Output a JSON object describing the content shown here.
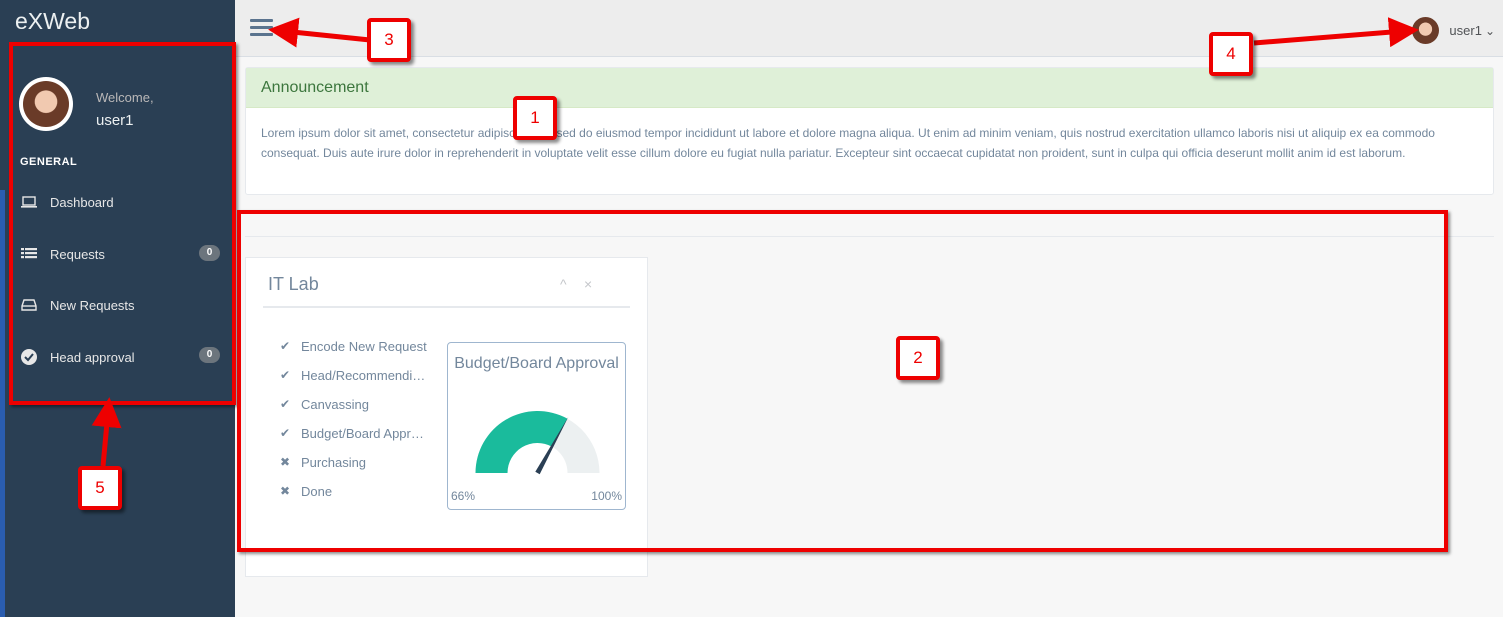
{
  "app": {
    "brand": "eXWeb"
  },
  "sidebar": {
    "welcome": "Welcome,",
    "username": "user1",
    "section": "GENERAL",
    "items": [
      {
        "label": "Dashboard",
        "icon": "laptop-icon",
        "badge": ""
      },
      {
        "label": "Requests",
        "icon": "list-icon",
        "badge": "0"
      },
      {
        "label": "New Requests",
        "icon": "inbox-icon",
        "badge": ""
      },
      {
        "label": "Head approval",
        "icon": "check-circle-icon",
        "badge": "0"
      }
    ]
  },
  "topbar": {
    "user": "user1",
    "caret": "⌄"
  },
  "announcement": {
    "title": "Announcement",
    "body": "Lorem ipsum dolor sit amet, consectetur adipiscing elit, sed do eiusmod tempor incididunt ut labore et dolore magna aliqua. Ut enim ad minim veniam, quis nostrud exercitation ullamco laboris nisi ut aliquip ex ea commodo consequat. Duis aute irure dolor in reprehenderit in voluptate velit esse cillum dolore eu fugiat nulla pariatur. Excepteur sint occaecat cupidatat non proident, sunt in culpa qui officia deserunt mollit anim id est laborum."
  },
  "panel": {
    "title": "IT Lab",
    "collapse_icon": "^",
    "close_icon": "×",
    "steps": [
      {
        "label": "Encode New Request",
        "status": "done",
        "icon": "✔"
      },
      {
        "label": "Head/Recommending Approval",
        "status": "done",
        "icon": "✔"
      },
      {
        "label": "Canvassing",
        "status": "done",
        "icon": "✔"
      },
      {
        "label": "Budget/Board Approval",
        "status": "done",
        "icon": "✔"
      },
      {
        "label": "Purchasing",
        "status": "pending",
        "icon": "✖"
      },
      {
        "label": "Done",
        "status": "pending",
        "icon": "✖"
      }
    ],
    "gauge": {
      "title": "Budget/Board Approval",
      "value": 66,
      "min_label": "66%",
      "max_label": "100%",
      "fill_color": "#1ABB9C",
      "track_color": "#ECF0F1"
    }
  },
  "annotations": {
    "callouts": [
      "1",
      "2",
      "3",
      "4",
      "5"
    ],
    "color": "#ee0000"
  }
}
